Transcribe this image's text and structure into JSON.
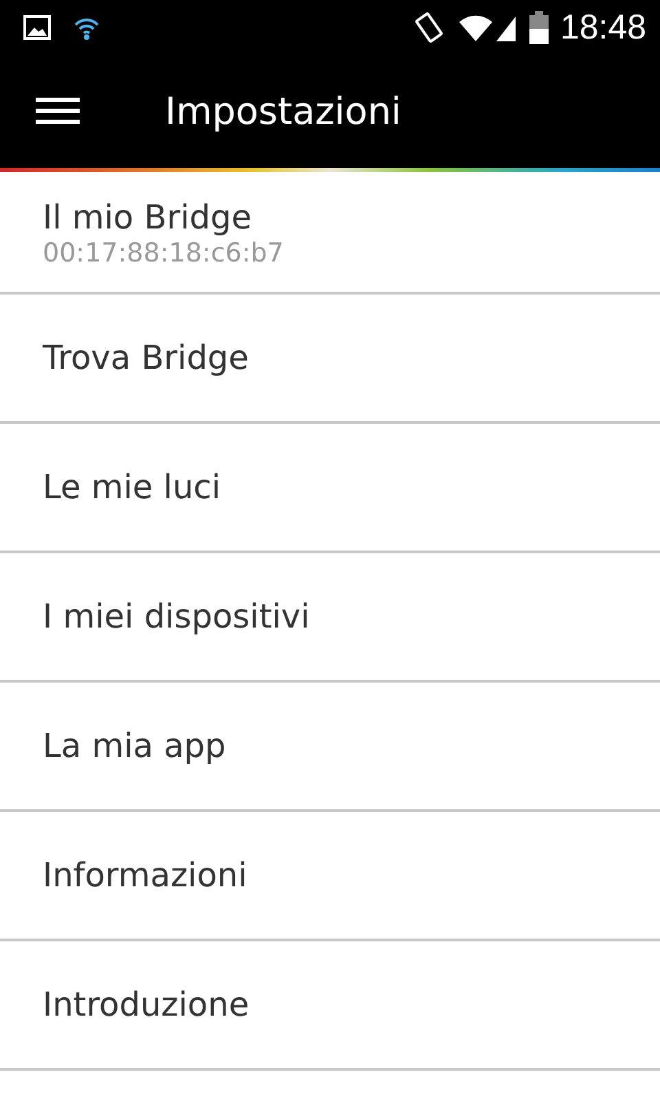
{
  "status_bar": {
    "time": "18:48"
  },
  "app_bar": {
    "title": "Impostazioni"
  },
  "items": [
    {
      "label": "Il mio Bridge",
      "subtitle": "00:17:88:18:c6:b7"
    },
    {
      "label": "Trova Bridge"
    },
    {
      "label": "Le mie luci"
    },
    {
      "label": "I miei dispositivi"
    },
    {
      "label": "La mia app"
    },
    {
      "label": "Informazioni"
    },
    {
      "label": "Introduzione"
    }
  ]
}
